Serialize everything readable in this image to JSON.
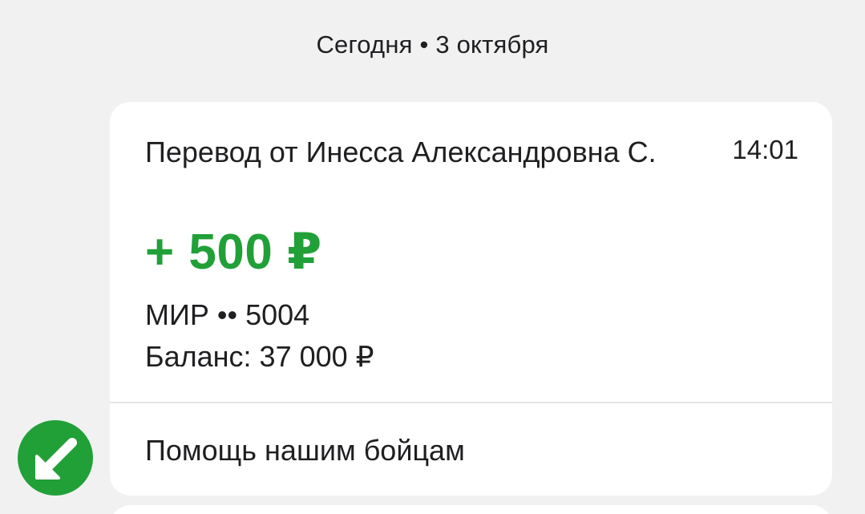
{
  "feed": {
    "date_header": "Сегодня • 3 октября"
  },
  "transaction": {
    "title": "Перевод от Инесса Александровна С.",
    "time": "14:01",
    "amount": "+ 500 ₽",
    "account": "МИР •• 5004",
    "balance": "Баланс: 37 000 ₽",
    "purpose": "Помощь нашим бойцам",
    "direction_icon": "incoming-arrow-icon",
    "colors": {
      "amount": "#21a038",
      "badge": "#21a038",
      "background": "#f1f1f2",
      "card": "#ffffff"
    }
  }
}
